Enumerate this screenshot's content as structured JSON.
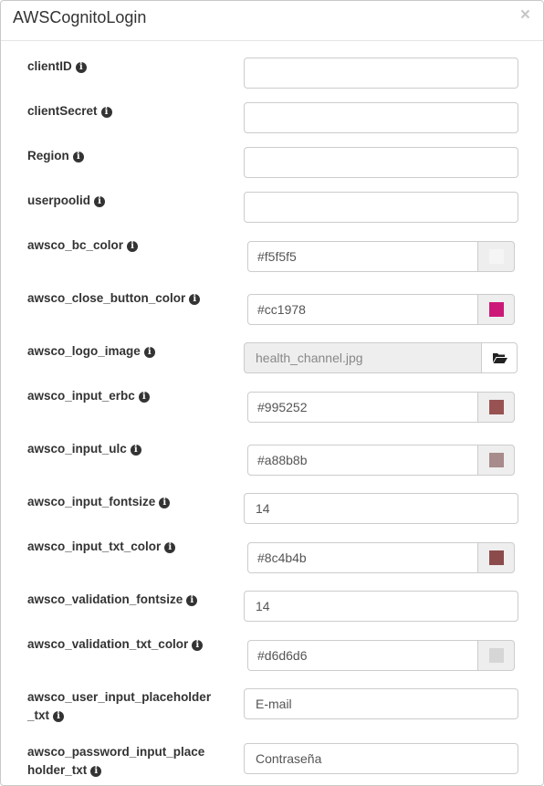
{
  "dialog": {
    "title": "AWSCognitoLogin",
    "close_glyph": "×"
  },
  "info_glyph": "i",
  "fields": {
    "clientID": {
      "label": "clientID",
      "value": ""
    },
    "clientSecret": {
      "label": "clientSecret",
      "value": ""
    },
    "region": {
      "label": "Region",
      "value": ""
    },
    "userpoolid": {
      "label": "userpoolid",
      "value": ""
    },
    "bc_color": {
      "label": "awsco_bc_color",
      "value": "#f5f5f5",
      "swatch": "#f5f5f5"
    },
    "close_button_color": {
      "label": "awsco_close_button_color",
      "value": "#cc1978",
      "swatch": "#cc1978"
    },
    "logo_image": {
      "label": "awsco_logo_image",
      "value": "health_channel.jpg",
      "icon": "folder-open-icon"
    },
    "input_erbc": {
      "label": "awsco_input_erbc",
      "value": "#995252",
      "swatch": "#995252"
    },
    "input_ulc": {
      "label": "awsco_input_ulc",
      "value": "#a88b8b",
      "swatch": "#a88b8b"
    },
    "input_fontsize": {
      "label": "awsco_input_fontsize",
      "value": "14"
    },
    "input_txt_color": {
      "label": "awsco_input_txt_color",
      "value": "#8c4b4b",
      "swatch": "#8c4b4b"
    },
    "validation_fontsize": {
      "label": "awsco_validation_fontsize",
      "value": "14"
    },
    "validation_txt_color": {
      "label": "awsco_validation_txt_color",
      "value": "#d6d6d6",
      "swatch": "#d6d6d6"
    },
    "user_input_placeholder": {
      "label_line1": "awsco_user_input_placeholder",
      "label_line2": "_txt",
      "value": "E-mail"
    },
    "password_input_placeholder": {
      "label_line1": "awsco_password_input_place",
      "label_line2": "holder_txt",
      "value": "Contraseña"
    }
  }
}
